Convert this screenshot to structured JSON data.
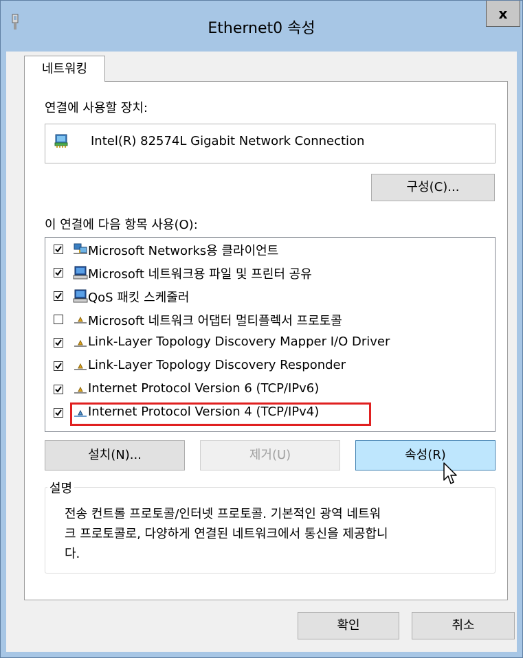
{
  "window": {
    "title": "Ethernet0 속성",
    "close_label": "x"
  },
  "tabs": [
    {
      "label": "네트워킹",
      "selected": true
    }
  ],
  "connect_using": {
    "label": "연결에 사용할 장치:",
    "device_name": "Intel(R) 82574L Gigabit Network Connection",
    "device_icon": "network-adapter-icon",
    "configure_label": "구성(C)..."
  },
  "components": {
    "label": "이 연결에 다음 항목 사용(O):",
    "items": [
      {
        "label": "Microsoft Networks용 클라이언트",
        "checked": true,
        "icon": "network-client-icon"
      },
      {
        "label": "Microsoft 네트워크용 파일 및 프린터 공유",
        "checked": true,
        "icon": "computer-icon"
      },
      {
        "label": "QoS 패킷 스케줄러",
        "checked": true,
        "icon": "computer-icon"
      },
      {
        "label": "Microsoft 네트워크 어댑터 멀티플렉서 프로토콜",
        "checked": false,
        "icon": "protocol-icon"
      },
      {
        "label": "Link-Layer Topology Discovery Mapper I/O Driver",
        "checked": true,
        "icon": "protocol-icon"
      },
      {
        "label": "Link-Layer Topology Discovery Responder",
        "checked": true,
        "icon": "protocol-icon"
      },
      {
        "label": "Internet Protocol Version 6 (TCP/IPv6)",
        "checked": true,
        "icon": "protocol-icon"
      },
      {
        "label": "Internet Protocol Version 4 (TCP/IPv4)",
        "checked": true,
        "icon": "protocol-icon",
        "highlighted": true
      }
    ]
  },
  "actions": {
    "install_label": "설치(N)...",
    "uninstall_label": "제거(U)",
    "properties_label": "속성(R)"
  },
  "description": {
    "legend": "설명",
    "line1": "전송 컨트롤 프로토콜/인터넷 프로토콜. 기본적인 광역 네트워",
    "line2": "크 프로토콜로, 다양하게 연결된 네트워크에서 통신을 제공합니",
    "line3": "다."
  },
  "footer": {
    "ok_label": "확인",
    "cancel_label": "취소"
  },
  "colors": {
    "frame": "#a7c6e5",
    "highlight_border": "#e02020",
    "hover_button": "#bee6fd"
  }
}
